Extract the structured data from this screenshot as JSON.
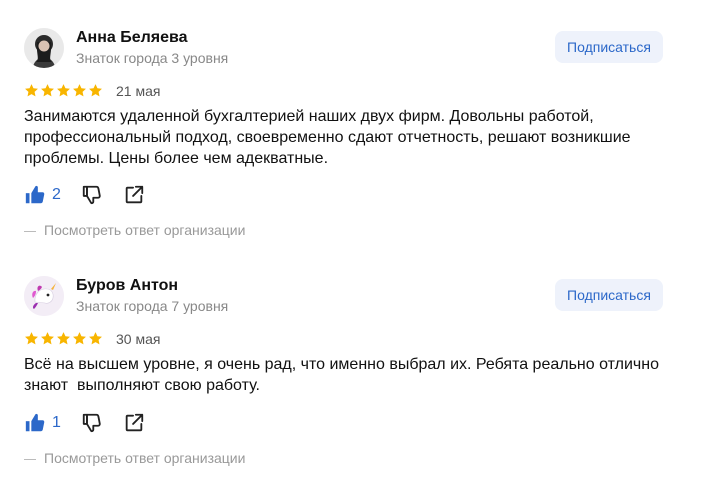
{
  "reviews": [
    {
      "author": "Анна Беляева",
      "level": "Знаток города 3 уровня",
      "subscribe_label": "Подписаться",
      "rating": 5,
      "date": "21 мая",
      "text": "Занимаются удаленной бухгалтерией наших двух фирм. Довольны работой,\nпрофессиональный подход, своевременно сдают отчетность, решают возникшие\nпроблемы. Цены более чем адекватные.",
      "likes": "2",
      "org_answer_link": "Посмотреть ответ организации"
    },
    {
      "author": "Буров Антон",
      "level": "Знаток города 7 уровня",
      "subscribe_label": "Подписаться",
      "rating": 5,
      "date": "30 мая",
      "text": "Всё на высшем уровне, я очень рад, что именно выбрал их. Ребята реально отлично\nзнают  выполняют свою работу.",
      "likes": "1",
      "org_answer_link": "Посмотреть ответ организации"
    }
  ],
  "colors": {
    "star": "#f8b500",
    "accent": "#2c68c9",
    "subscribe_bg": "#eef2fb"
  },
  "icons": [
    "star-icon",
    "thumbs-up-icon",
    "thumbs-down-icon",
    "share-icon"
  ]
}
